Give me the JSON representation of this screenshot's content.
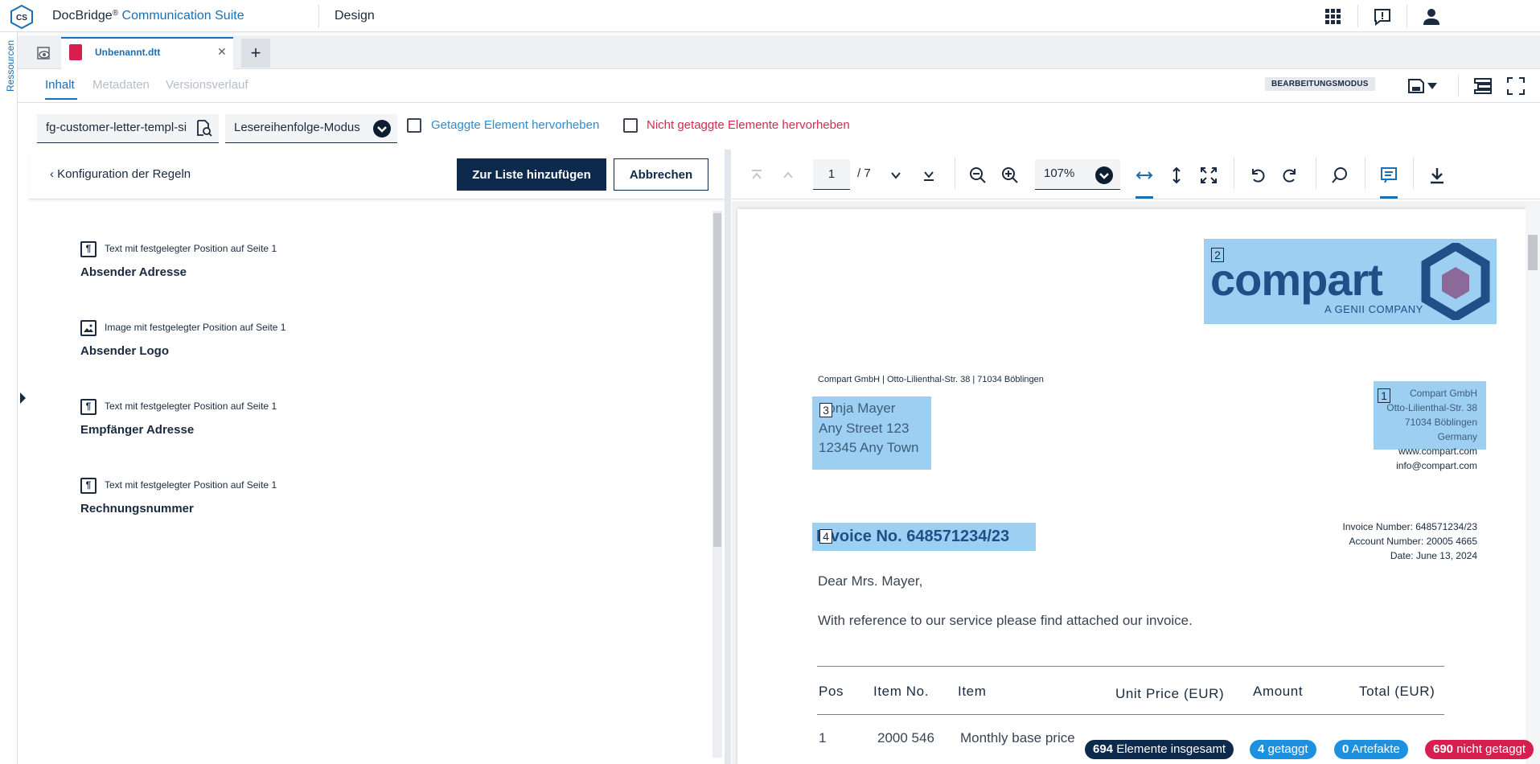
{
  "app": {
    "brand": "DocBridge",
    "reg": "®",
    "suite": "Communication Suite",
    "badge": "CS",
    "section": "Design"
  },
  "rail": {
    "label": "Ressourcen"
  },
  "tabs": {
    "doc_label": "Unbenannt.dtt",
    "close": "✕",
    "add": "+"
  },
  "subnav": {
    "inhalt": "Inhalt",
    "metadaten": "Metadaten",
    "versionsverlauf": "Versionsverlauf",
    "mode_badge": "BEARBEITUNGSMODUS"
  },
  "toolbar": {
    "filter_value": "fg-customer-letter-templ-si",
    "mode_value": "Lesereihenfolge-Modus",
    "cb_tagged": "Getaggte Element hervorheben",
    "cb_untagged": "Nicht getaggte Elemente hervorheben"
  },
  "left": {
    "back": "Konfiguration der Regeln",
    "btn_add": "Zur Liste hinzufügen",
    "btn_cancel": "Abbrechen",
    "rules": [
      {
        "icon": "¶",
        "sub": "Text mit festgelegter Position auf Seite 1",
        "title": "Absender Adresse"
      },
      {
        "icon": "▲",
        "sub": "Image mit festgelegter Position auf Seite 1",
        "title": "Absender Logo"
      },
      {
        "icon": "¶",
        "sub": "Text mit festgelegter Position auf Seite 1",
        "title": "Empfänger Adresse"
      },
      {
        "icon": "¶",
        "sub": "Text mit festgelegter Position auf Seite 1",
        "title": "Rechnungsnummer"
      }
    ]
  },
  "viewer": {
    "page": "1",
    "total": "/ 7",
    "zoom": "107%"
  },
  "document": {
    "logo_word": "compart",
    "logo_sub": "A GENII COMPANY",
    "sender_line": "Compart GmbH | Otto-Lilienthal-Str. 38 | 71034 Böblingen",
    "recipient": [
      "Sonja Mayer",
      "Any Street 123",
      "12345 Any Town"
    ],
    "company": [
      "Compart GmbH",
      "Otto-Lilienthal-Str. 38",
      "71034 Böblingen",
      "Germany",
      "www.compart.com",
      "info@compart.com"
    ],
    "invoice_title": "Invoice No. 648571234/23",
    "invoice_meta": [
      "Invoice Number: 648571234/23",
      "Account Number: 20005 4665",
      "Date: June 13, 2024"
    ],
    "greeting": "Dear Mrs. Mayer,",
    "intro": "With reference to our service please find attached our invoice.",
    "table_headers": [
      "Pos",
      "Item No.",
      "Item",
      "Unit Price (EUR)",
      "Amount",
      "Total (EUR)"
    ],
    "table_row": [
      "1",
      "2000 546",
      "Monthly base price"
    ],
    "tag_numbers": [
      "1",
      "2",
      "3",
      "4"
    ]
  },
  "status": {
    "total_count": "694",
    "total_label": "Elemente insgesamt",
    "tagged_count": "4",
    "tagged_label": "getaggt",
    "artifacts_count": "0",
    "artifacts_label": "Artefakte",
    "untagged_count": "690",
    "untagged_label": "nicht getaggt"
  },
  "colors": {
    "accent": "#1a6fb5",
    "navy": "#0d2a4d",
    "highlight": "#3ca0e6",
    "pill_dark": "#0d2a4d",
    "pill_blue": "#1e90e0",
    "pill_red": "#d61f4f"
  }
}
